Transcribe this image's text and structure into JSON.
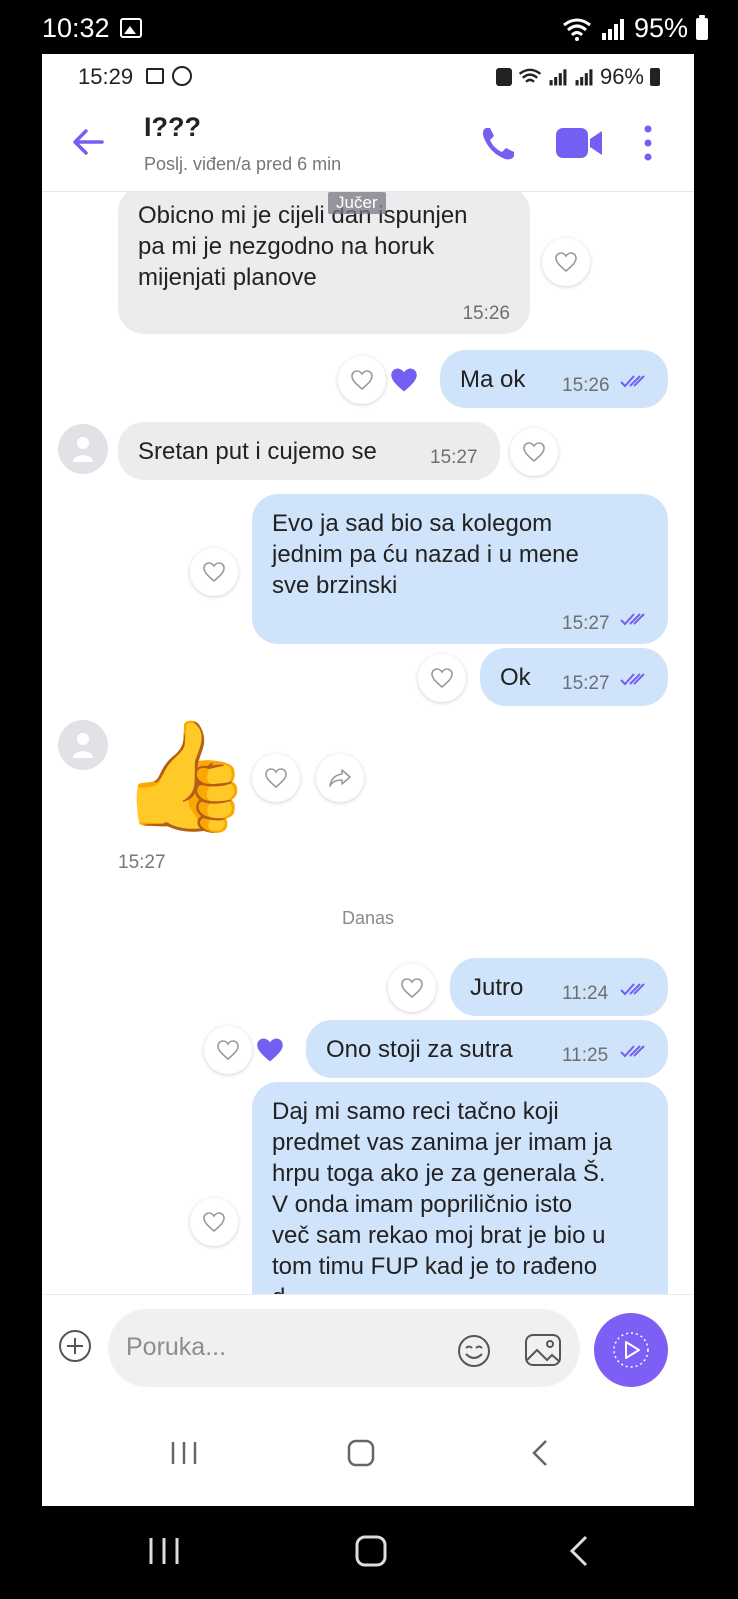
{
  "device": {
    "outer_time": "10:32",
    "outer_battery": "95%",
    "inner_time": "15:29",
    "inner_battery": "96%"
  },
  "header": {
    "contact_name": "I???",
    "last_seen": "Poslj. viđen/a pred 6 min",
    "icons": [
      "back-arrow-icon",
      "phone-icon",
      "video-call-icon",
      "more-vert-icon"
    ],
    "accent_color": "#7360f2"
  },
  "chat": {
    "day_chip_yesterday": "Jučer",
    "day_label_today": "Danas",
    "messages": [
      {
        "dir": "in",
        "lines": [
          "Obicno mi je cijeli dan ispunjen",
          "pa mi je nezgodno na horuk",
          "mijenjati planove"
        ],
        "time": "15:26"
      },
      {
        "dir": "out",
        "text": "Ma ok",
        "time": "15:26",
        "liked": true
      },
      {
        "dir": "in",
        "text": "Sretan put i cujemo se",
        "time": "15:27"
      },
      {
        "dir": "out",
        "lines": [
          "Evo ja sad bio sa kolegom",
          "jednim pa ću nazad i u mene",
          "sve brzinski"
        ],
        "time": "15:27"
      },
      {
        "dir": "out",
        "text": "Ok",
        "time": "15:27"
      },
      {
        "dir": "in",
        "sticker": "👍",
        "time": "15:27"
      },
      {
        "dir": "out",
        "text": "Jutro",
        "time": "11:24"
      },
      {
        "dir": "out",
        "text": "Ono stoji za sutra",
        "time": "11:25",
        "liked": true
      },
      {
        "dir": "out",
        "lines": [
          "Daj mi samo reci tačno koji",
          "predmet vas zanima jer imam ja",
          "hrpu toga ako je za generala Š.",
          "V onda imam popriličnio isto",
          "več sam rekao moj brat je bio u",
          "tom timu FUP kad je to rađeno",
          "d..."
        ]
      }
    ]
  },
  "composer": {
    "placeholder": "Poruka...",
    "icons": [
      "plus-icon",
      "emoji-icon",
      "gallery-icon",
      "send-icon"
    ],
    "send_color": "#7d5ff5"
  }
}
